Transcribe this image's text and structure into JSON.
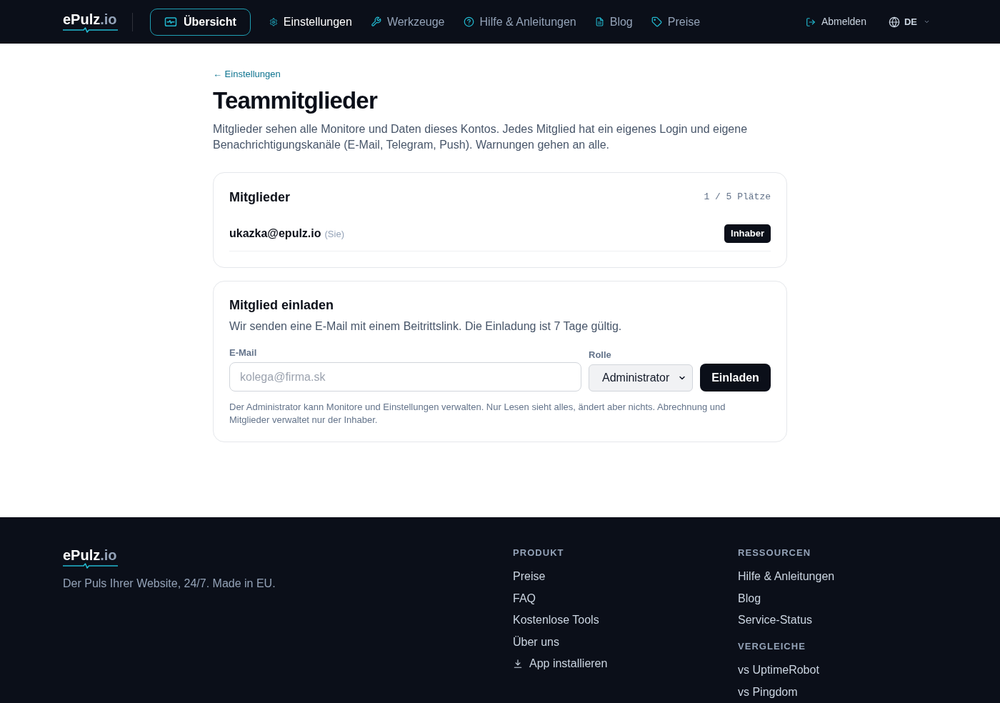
{
  "header": {
    "logo": {
      "name": "ePulz",
      "tld": ".io"
    },
    "nav": [
      {
        "label": "Übersicht",
        "kind": "button",
        "selected": false
      },
      {
        "label": "Einstellungen",
        "kind": "link",
        "selected": true
      },
      {
        "label": "Werkzeuge",
        "kind": "link",
        "selected": false
      },
      {
        "label": "Hilfe & Anleitungen",
        "kind": "link",
        "selected": false
      },
      {
        "label": "Blog",
        "kind": "link",
        "selected": false
      },
      {
        "label": "Preise",
        "kind": "link",
        "selected": false
      }
    ],
    "logout": "Abmelden",
    "language": "DE"
  },
  "page": {
    "back_link": "← Einstellungen",
    "title": "Teammitglieder",
    "description": "Mitglieder sehen alle Monitore und Daten dieses Kontos. Jedes Mitglied hat ein eigenes Login und eigene Benachrichtigungskanäle (E-Mail, Telegram, Push). Warnungen gehen an alle."
  },
  "members_card": {
    "title": "Mitglieder",
    "seats": "1 / 5 Plätze",
    "members": [
      {
        "email": "ukazka@epulz.io",
        "note": "(Sie)",
        "role": "Inhaber"
      }
    ]
  },
  "invite_card": {
    "title": "Mitglied einladen",
    "description": "Wir senden eine E-Mail mit einem Beitrittslink. Die Einladung ist 7 Tage gültig.",
    "email_field": {
      "label": "E-Mail",
      "placeholder": "kolega@firma.sk"
    },
    "role_field": {
      "label": "Rolle",
      "value": "Administrator"
    },
    "submit": "Einladen",
    "help": "Der Administrator kann Monitore und Einstellungen verwalten. Nur Lesen sieht alles, ändert aber nichts. Abrechnung und Mitglieder verwaltet nur der Inhaber."
  },
  "footer": {
    "logo": {
      "name": "ePulz",
      "tld": ".io"
    },
    "tagline": "Der Puls Ihrer Website, 24/7. Made in EU.",
    "columns": [
      {
        "sections": [
          {
            "heading": "PRODUKT",
            "links": [
              {
                "label": "Preise",
                "kind": "link"
              },
              {
                "label": "FAQ",
                "kind": "link"
              },
              {
                "label": "Kostenlose Tools",
                "kind": "link"
              },
              {
                "label": "Über uns",
                "kind": "link"
              },
              {
                "label": "App installieren",
                "kind": "download"
              }
            ]
          }
        ]
      },
      {
        "sections": [
          {
            "heading": "RESSOURCEN",
            "links": [
              {
                "label": "Hilfe & Anleitungen",
                "kind": "link"
              },
              {
                "label": "Blog",
                "kind": "link"
              },
              {
                "label": "Service-Status",
                "kind": "link"
              }
            ]
          },
          {
            "heading": "VERGLEICHE",
            "links": [
              {
                "label": "vs UptimeRobot",
                "kind": "link"
              },
              {
                "label": "vs Pingdom",
                "kind": "link"
              }
            ]
          }
        ]
      }
    ]
  }
}
